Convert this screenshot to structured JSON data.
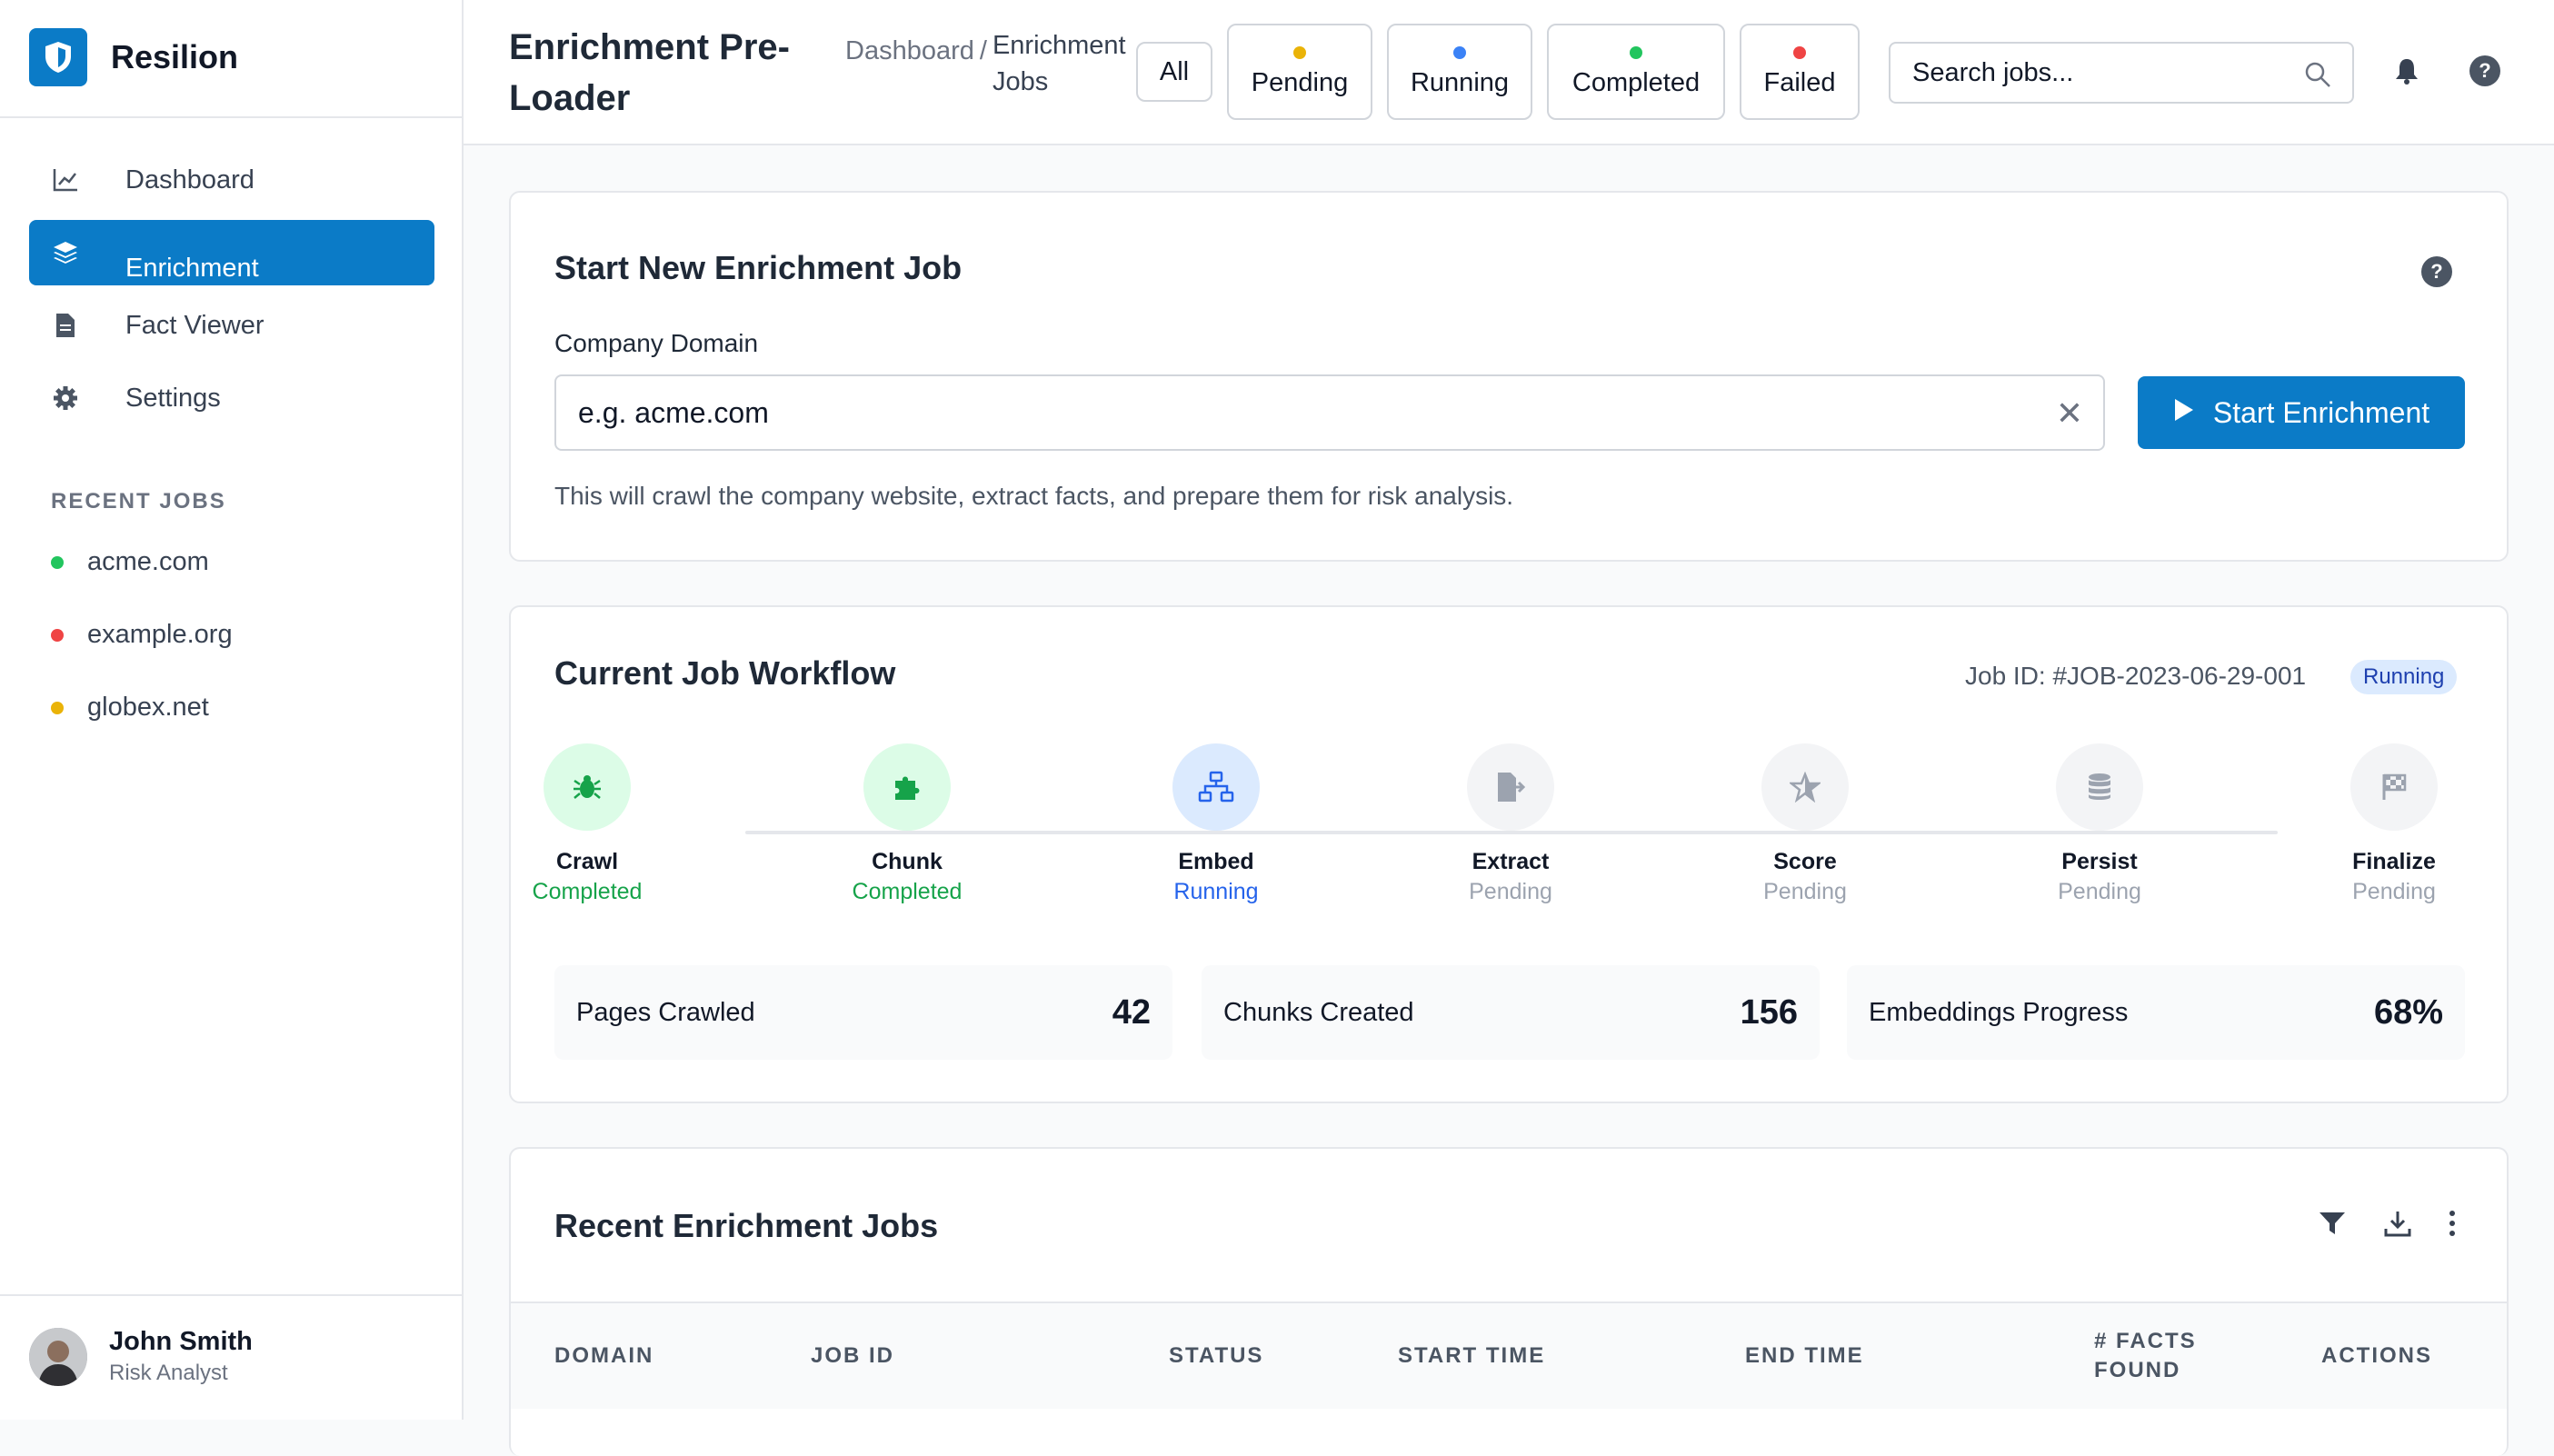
{
  "app": {
    "name": "Resilion"
  },
  "sidebar": {
    "nav": [
      {
        "label": "Dashboard",
        "icon": "chart-line-icon"
      },
      {
        "label": "Enrichment Jobs",
        "icon": "layers-icon",
        "active": true
      },
      {
        "label": "Fact Viewer",
        "icon": "document-icon"
      },
      {
        "label": "Settings",
        "icon": "gear-icon"
      }
    ],
    "recent_title": "RECENT JOBS",
    "recent": [
      {
        "label": "acme.com",
        "color": "#22c55e"
      },
      {
        "label": "example.org",
        "color": "#ef4444"
      },
      {
        "label": "globex.net",
        "color": "#eab308"
      }
    ],
    "user": {
      "name": "John Smith",
      "role": "Risk Analyst"
    }
  },
  "header": {
    "title": "Enrichment Pre-Loader",
    "breadcrumb": {
      "root": "Dashboard",
      "separator": "/",
      "current": "Enrichment Jobs"
    },
    "filters": [
      {
        "label": "All"
      },
      {
        "label": "Pending",
        "color": "#eab308"
      },
      {
        "label": "Running",
        "color": "#3b82f6"
      },
      {
        "label": "Completed",
        "color": "#22c55e"
      },
      {
        "label": "Failed",
        "color": "#ef4444"
      }
    ],
    "search_placeholder": "Search jobs..."
  },
  "start_job": {
    "title": "Start New Enrichment Job",
    "field_label": "Company Domain",
    "placeholder": "e.g. acme.com",
    "button": "Start Enrichment",
    "helper": "This will crawl the company website, extract facts, and prepare them for risk analysis."
  },
  "workflow": {
    "title": "Current Job Workflow",
    "job_id": "Job ID: #JOB-2023-06-29-001",
    "status_badge": "Running",
    "steps": [
      {
        "name": "Crawl",
        "status": "Completed",
        "icon": "bug-icon"
      },
      {
        "name": "Chunk",
        "status": "Completed",
        "icon": "puzzle-icon"
      },
      {
        "name": "Embed",
        "status": "Running",
        "icon": "network-icon"
      },
      {
        "name": "Extract",
        "status": "Pending",
        "icon": "file-export-icon"
      },
      {
        "name": "Score",
        "status": "Pending",
        "icon": "star-icon"
      },
      {
        "name": "Persist",
        "status": "Pending",
        "icon": "database-icon"
      },
      {
        "name": "Finalize",
        "status": "Pending",
        "icon": "flag-icon"
      }
    ],
    "stats": [
      {
        "label": "Pages Crawled",
        "value": "42"
      },
      {
        "label": "Chunks Created",
        "value": "156"
      },
      {
        "label": "Embeddings Progress",
        "value": "68%"
      }
    ]
  },
  "recent_jobs": {
    "title": "Recent Enrichment Jobs",
    "columns": [
      "DOMAIN",
      "JOB ID",
      "STATUS",
      "START TIME",
      "END TIME",
      "# FACTS FOUND",
      "ACTIONS"
    ]
  },
  "colors": {
    "accent": "#0b7bc7",
    "completed": "#16a34a",
    "running": "#2563eb",
    "pending": "#9ca3af"
  }
}
